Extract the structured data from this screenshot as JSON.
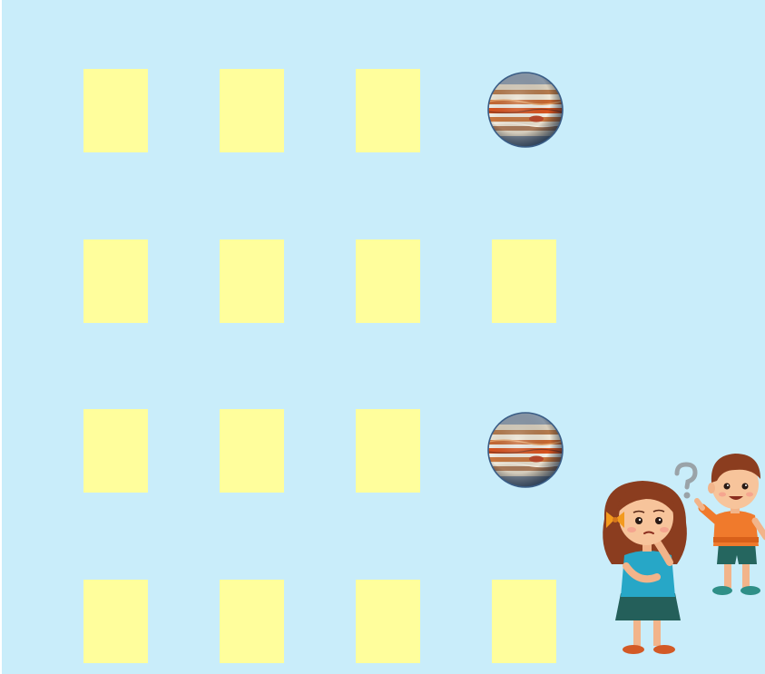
{
  "game": {
    "background_color": "#C9EDFA",
    "card_color": "#FFFE9C",
    "grid": [
      [
        "card",
        "card",
        "card",
        "planet"
      ],
      [
        "card",
        "card",
        "card",
        "card"
      ],
      [
        "card",
        "card",
        "card",
        "planet"
      ],
      [
        "card",
        "card",
        "card",
        "card"
      ]
    ],
    "revealed_item": "jupiter-planet",
    "mascot": "two-kids-thinking-illustration"
  }
}
